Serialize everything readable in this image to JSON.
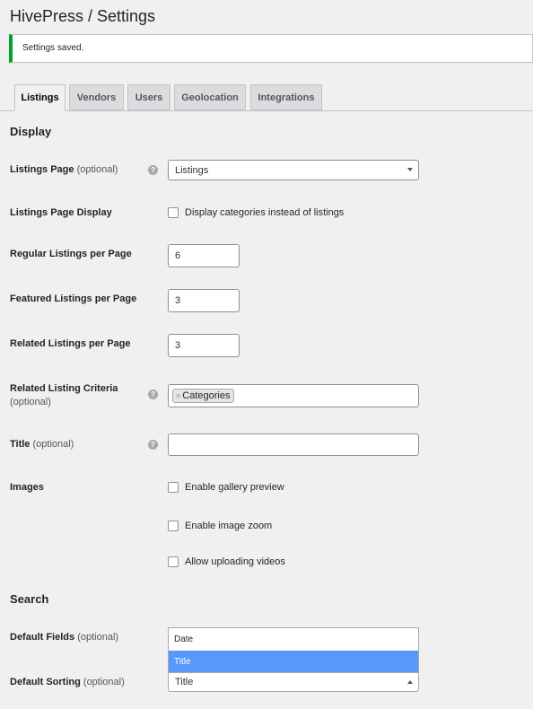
{
  "page": {
    "title": "HivePress / Settings"
  },
  "notice": {
    "text": "Settings saved."
  },
  "tabs": [
    {
      "label": "Listings",
      "active": true
    },
    {
      "label": "Vendors"
    },
    {
      "label": "Users"
    },
    {
      "label": "Geolocation"
    },
    {
      "label": "Integrations"
    }
  ],
  "sections": {
    "display": "Display",
    "search": "Search"
  },
  "fields": {
    "listings_page": {
      "label": "Listings Page",
      "optional": "(optional)",
      "value": "Listings"
    },
    "listings_page_display": {
      "label": "Listings Page Display",
      "checkbox": "Display categories instead of listings"
    },
    "regular_per_page": {
      "label": "Regular Listings per Page",
      "value": "6"
    },
    "featured_per_page": {
      "label": "Featured Listings per Page",
      "value": "3"
    },
    "related_per_page": {
      "label": "Related Listings per Page",
      "value": "3"
    },
    "related_criteria": {
      "label": "Related Listing Criteria",
      "optional": "(optional)",
      "tag": "Categories",
      "remove": "×"
    },
    "title": {
      "label": "Title",
      "optional": "(optional)",
      "value": ""
    },
    "images": {
      "label": "Images",
      "options": [
        "Enable gallery preview",
        "Enable image zoom",
        "Allow uploading videos"
      ]
    },
    "default_fields": {
      "label": "Default Fields",
      "optional": "(optional)"
    },
    "default_sorting": {
      "label": "Default Sorting",
      "optional": "(optional)",
      "value": "Title",
      "options": [
        "Date",
        "Title"
      ],
      "highlighted": "Title"
    }
  },
  "help_glyph": "?",
  "colors": {
    "accent_notice": "#00a32a",
    "highlight": "#5897fb"
  }
}
